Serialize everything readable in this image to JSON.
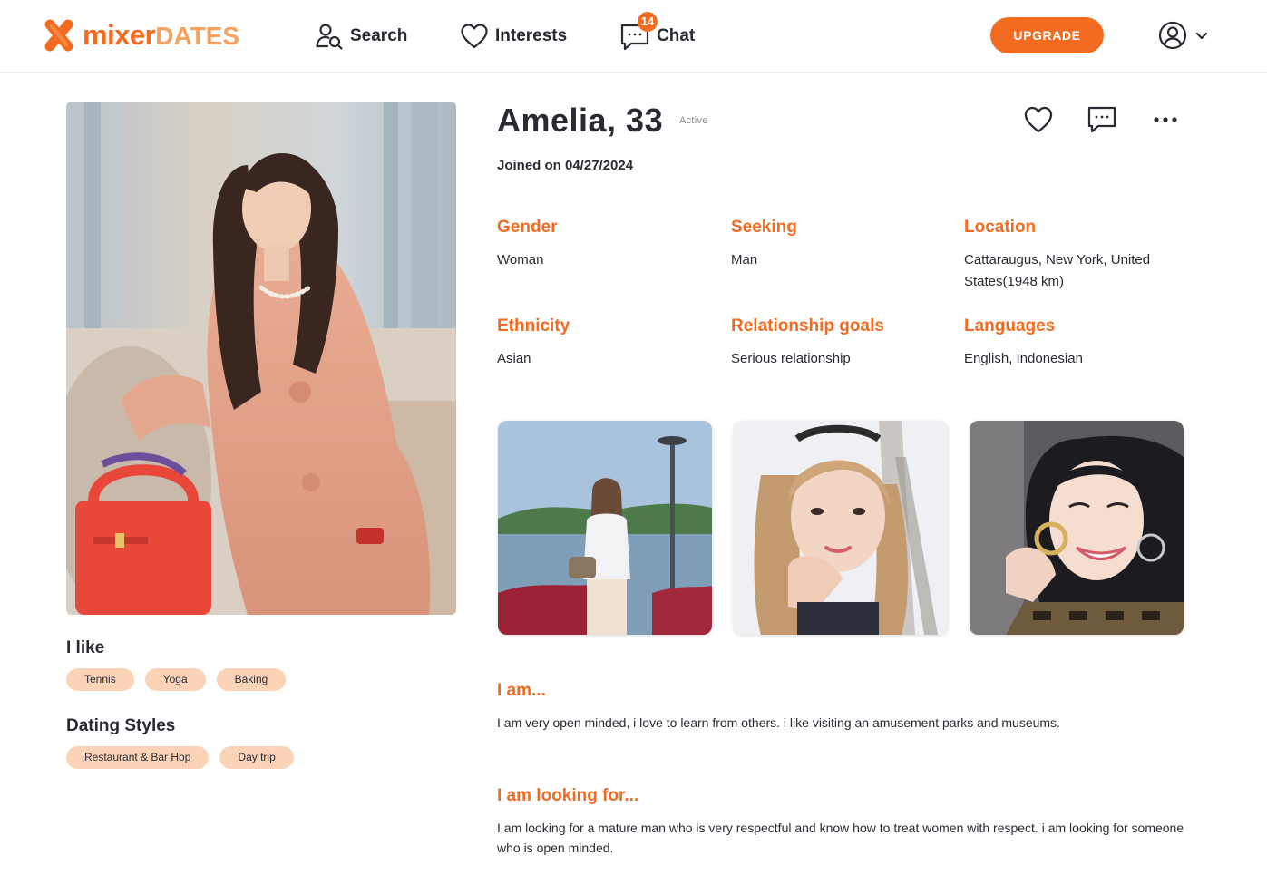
{
  "brand": {
    "name_part1": "mixer",
    "name_part2": "DATES",
    "accent_color": "#f26b21",
    "light_accent_color": "#f6a15e",
    "tag_color": "#fbd4b8"
  },
  "nav": {
    "search_label": "Search",
    "interests_label": "Interests",
    "chat_label": "Chat",
    "chat_badge_count": "14",
    "upgrade_label": "UPGRADE"
  },
  "profile": {
    "name_age": "Amelia, 33",
    "status": "Active",
    "joined": "Joined on 04/27/2024",
    "attributes": [
      {
        "label": "Gender",
        "value": "Woman"
      },
      {
        "label": "Seeking",
        "value": "Man"
      },
      {
        "label": "Location",
        "value": "Cattaraugus, New York, United States(1948 km)"
      },
      {
        "label": "Ethnicity",
        "value": "Asian"
      },
      {
        "label": "Relationship goals",
        "value": "Serious relationship"
      },
      {
        "label": "Languages",
        "value": "English, Indonesian"
      }
    ],
    "photos": [
      {
        "alt": "main profile photo"
      },
      {
        "alt": "photo by the lake"
      },
      {
        "alt": "selfie with hand on cheek"
      },
      {
        "alt": "smiling close-up"
      }
    ]
  },
  "likes": {
    "heading": "I like",
    "items": [
      "Tennis",
      "Yoga",
      "Baking"
    ]
  },
  "dating_styles": {
    "heading": "Dating Styles",
    "items": [
      "Restaurant & Bar Hop",
      "Day trip"
    ]
  },
  "about": {
    "i_am_heading": "I am...",
    "i_am_text": "I am very open minded, i love to learn from others. i like visiting an amusement parks and museums.",
    "looking_for_heading": "I am looking for...",
    "looking_for_text": "I am looking for a mature man who is very respectful and know how to treat women with respect. i am looking for someone who is open minded."
  },
  "icons": [
    "x-logo-icon",
    "search-user-icon",
    "heart-icon",
    "chat-icon",
    "user-circle-icon",
    "chevron-down-icon",
    "heart-outline-icon",
    "message-icon",
    "more-dots-icon"
  ]
}
